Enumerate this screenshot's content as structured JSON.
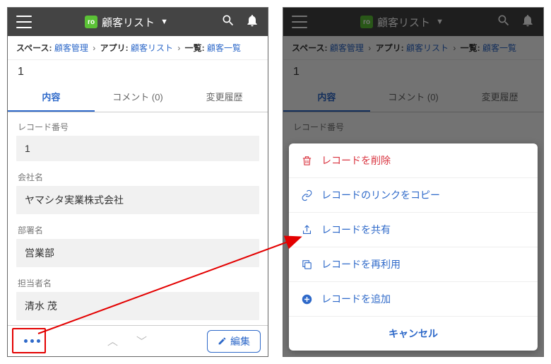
{
  "header": {
    "title": "顧客リスト",
    "app_icon_glyph": "ro"
  },
  "breadcrumb": {
    "space_label": "スペース:",
    "space": "顧客管理",
    "app_label": "アプリ:",
    "app": "顧客リスト",
    "view_label": "一覧:",
    "view": "顧客一覧"
  },
  "record_number_top": "1",
  "tabs": {
    "content": "内容",
    "comments": "コメント (0)",
    "history": "変更履歴"
  },
  "fields": {
    "recno_label": "レコード番号",
    "recno": "1",
    "company_label": "会社名",
    "company": "ヤマシタ実業株式会社",
    "dept_label": "部署名",
    "dept": "営業部",
    "person_label": "担当者名",
    "person": "清水 茂"
  },
  "bottom": {
    "edit": "編集"
  },
  "actions": {
    "delete": "レコードを削除",
    "copylink": "レコードのリンクをコピー",
    "share": "レコードを共有",
    "reuse": "レコードを再利用",
    "add": "レコードを追加",
    "cancel": "キャンセル"
  }
}
